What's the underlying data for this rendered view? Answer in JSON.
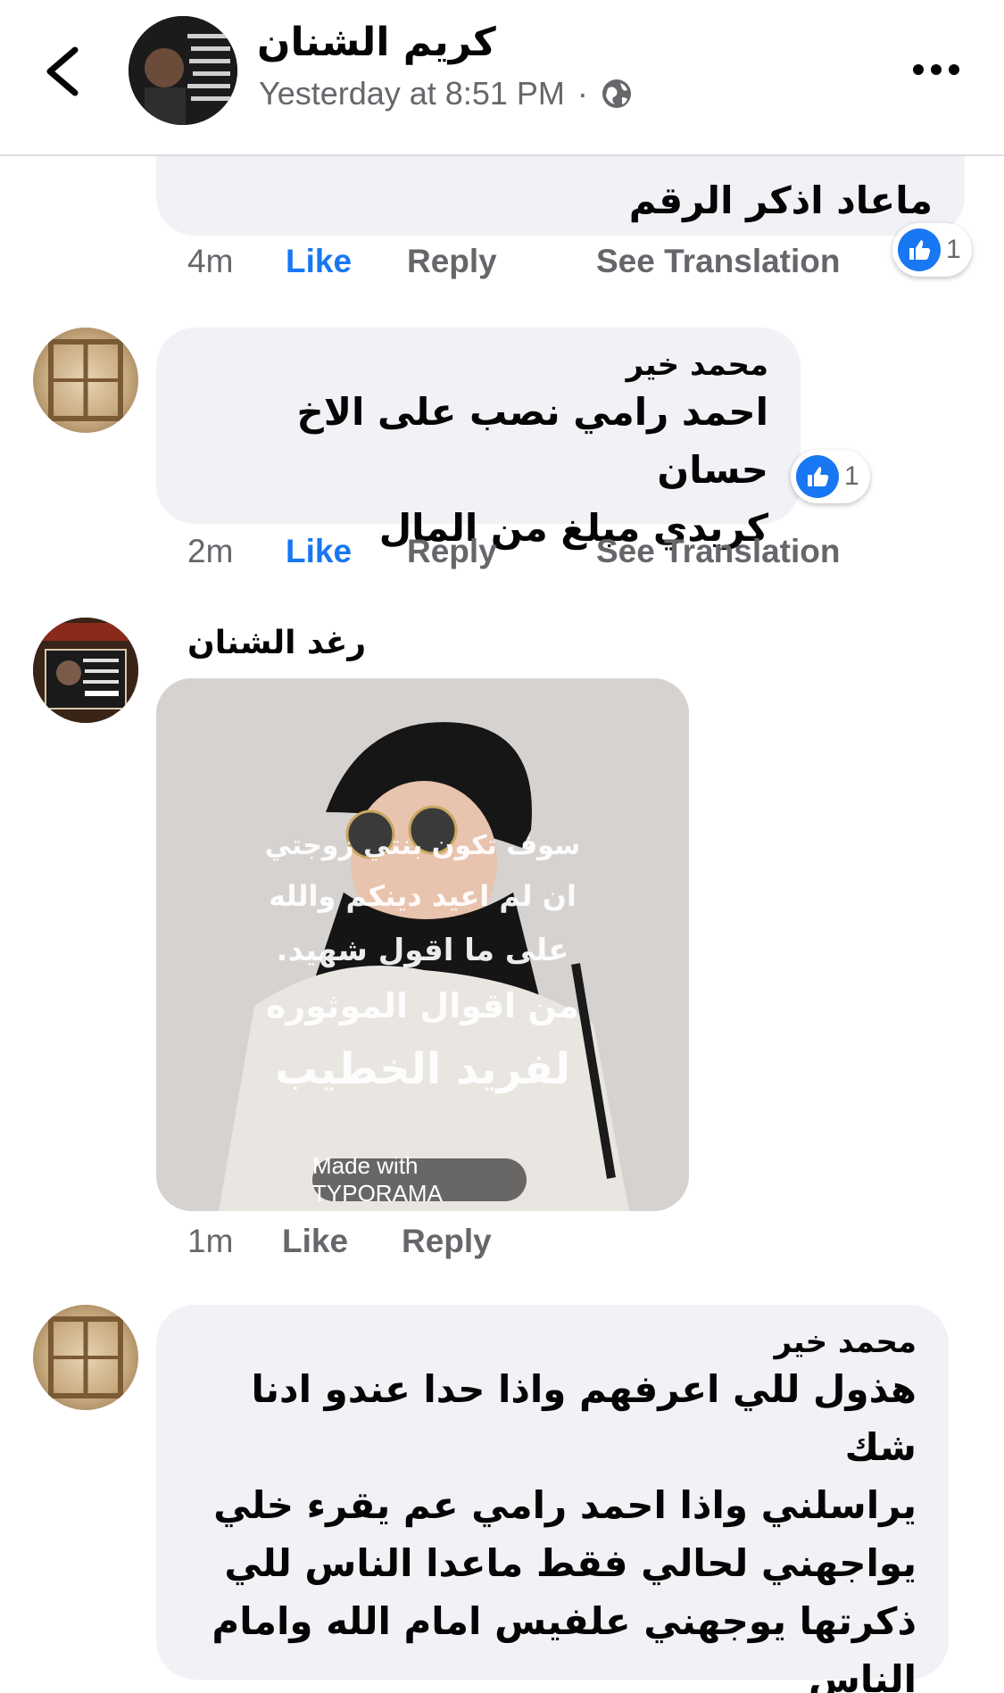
{
  "header": {
    "name": "كريم الشنان",
    "timestamp": "Yesterday at 8:51 PM",
    "separator": "·"
  },
  "comments": [
    {
      "text": "ماعاد اذكر الرقم",
      "time": "4m",
      "like": "Like",
      "reply": "Reply",
      "translate": "See Translation",
      "reactions": "1"
    },
    {
      "author": "محمد خير",
      "lines": [
        "احمد رامي نصب على الاخ حسان",
        "كريدي مبلغ من المال"
      ],
      "time": "2m",
      "like": "Like",
      "reply": "Reply",
      "translate": "See Translation",
      "reactions": "1"
    },
    {
      "author": "رغد الشنان",
      "image_text": [
        "سوف تكون بنتي زوجتي",
        "ان لم اعيد دينكم والله",
        "على ما اقول شهيد.",
        "من اقوال الموثوره",
        "لفريد الخطيب"
      ],
      "watermark": "Made with TYPORAMA",
      "time": "1m",
      "like": "Like",
      "reply": "Reply"
    },
    {
      "author": "محمد خير",
      "lines": [
        "هذول للي اعرفهم واذا حدا عندو ادنا شك",
        "يراسلني واذا احمد رامي عم يقرء خلي",
        "يواجهني لحالي فقط ماعدا الناس للي",
        "ذكرتها يوجهني علفيس امام الله وامام",
        "الناس"
      ]
    }
  ],
  "colors": {
    "like_blue": "#1877f2",
    "bubble": "#f0f2f5",
    "meta_gray": "#65676b"
  }
}
